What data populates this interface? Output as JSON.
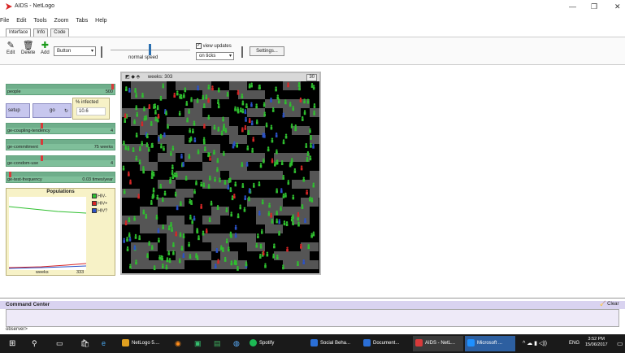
{
  "window": {
    "title": "AIDS - NetLogo",
    "controls": [
      "—",
      "❐",
      "✕"
    ]
  },
  "menu": [
    "File",
    "Edit",
    "Tools",
    "Zoom",
    "Tabs",
    "Help"
  ],
  "tabs": [
    "Interface",
    "Info",
    "Code"
  ],
  "toolbar": {
    "edit": "Edit",
    "delete": "Delete",
    "add": "Add",
    "widget_type": "Button",
    "speed_label": "normal speed",
    "view_updates": "view updates",
    "update_mode": "on ticks",
    "settings": "Settings..."
  },
  "widgets": {
    "people": {
      "name": "people",
      "value": "500"
    },
    "setup": "setup",
    "go": "go",
    "infected_label": "% infected",
    "infected_value": "10.6",
    "coupling": {
      "name": "ge-coupling-tendency",
      "value": "4"
    },
    "commitment": {
      "name": "ge-commitment",
      "value": "75 weeks"
    },
    "condom": {
      "name": "ge-condom-use",
      "value": "4"
    },
    "test": {
      "name": "ge-test-frequency",
      "value": "0.03 times/year"
    }
  },
  "plot": {
    "title": "Populations",
    "xlabel": "weeks",
    "xmax": "333",
    "legend": [
      {
        "name": "HIV-",
        "color": "#2fbf2f"
      },
      {
        "name": "HIV+",
        "color": "#d82626"
      },
      {
        "name": "HIV?",
        "color": "#2b52c8"
      }
    ]
  },
  "world": {
    "ticks_label": "weeks: 303",
    "speed_box": "30"
  },
  "command_center": {
    "title": "Command Center",
    "prompt": "observer>",
    "clear": "Clear"
  },
  "taskbar": {
    "apps": [
      {
        "label": "NetLogo 5....",
        "color": "#e0a020"
      },
      {
        "label": "Spotify",
        "color": "#1db954"
      },
      {
        "label": "Social Beha...",
        "color": "#2b6fd6"
      },
      {
        "label": "Document...",
        "color": "#2b6fd6"
      },
      {
        "label": "AIDS - NetL...",
        "color": "#d83a3a"
      },
      {
        "label": "Microsoft ...",
        "color": "#1e90ff"
      }
    ],
    "lang": "ENG",
    "time": "3:52 PM",
    "date": "15/06/2017"
  }
}
